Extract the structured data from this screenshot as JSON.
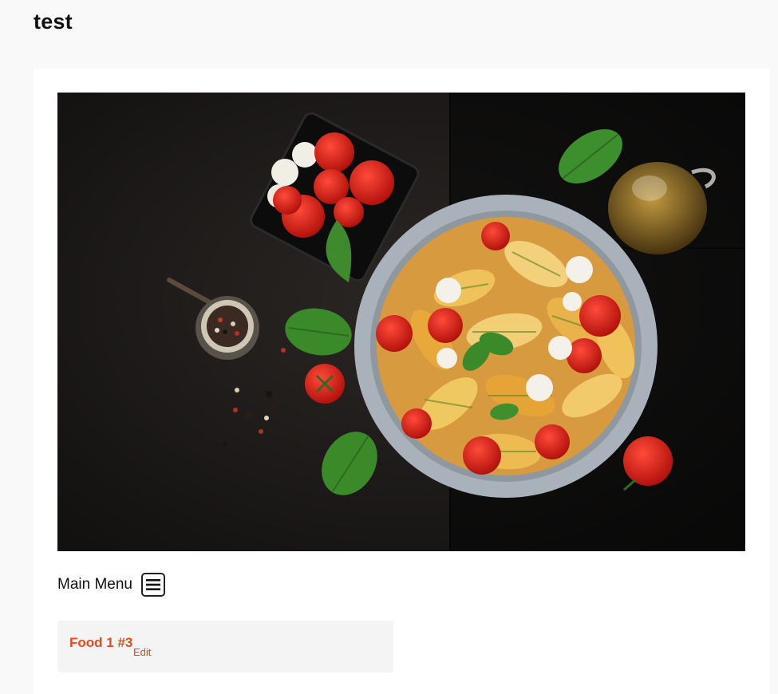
{
  "site": {
    "title": "test"
  },
  "hero": {
    "image_description_icon": "pasta-salad-photo"
  },
  "menu": {
    "label": "Main Menu",
    "toggle_icon": "hamburger-icon"
  },
  "posts": [
    {
      "title": "Food 1 #3",
      "edit_label": "Edit"
    }
  ],
  "colors": {
    "accent": "#e8491d",
    "page_bg": "#f9f9f9",
    "card_bg": "#ffffff",
    "post_bg": "#f4f4f4"
  }
}
